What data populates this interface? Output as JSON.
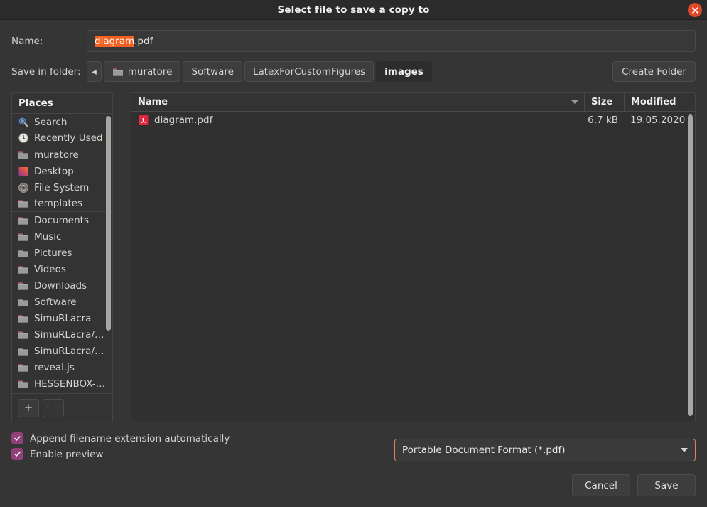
{
  "window": {
    "title": "Select file to save a copy to",
    "close_icon": "close-icon",
    "accent_color": "#e0482a"
  },
  "name_field": {
    "label": "Name:",
    "selected_text": "diagram",
    "rest_text": ".pdf",
    "full_value": "diagram.pdf"
  },
  "path_bar": {
    "label": "Save in folder:",
    "back_arrow": "◂",
    "crumbs": [
      {
        "label": "muratore",
        "icon": "folder-icon",
        "active": false
      },
      {
        "label": "Software",
        "icon": "",
        "active": false
      },
      {
        "label": "LatexForCustomFigures",
        "icon": "",
        "active": false
      },
      {
        "label": "images",
        "icon": "",
        "active": true
      }
    ],
    "create_folder_label": "Create Folder"
  },
  "sidebar": {
    "header": "Places",
    "items": [
      {
        "label": "Search",
        "icon": "search-icon"
      },
      {
        "label": "Recently Used",
        "icon": "recent-icon",
        "separator_after": true
      },
      {
        "label": "muratore",
        "icon": "folder-icon"
      },
      {
        "label": "Desktop",
        "icon": "desktop-icon"
      },
      {
        "label": "File System",
        "icon": "disk-icon"
      },
      {
        "label": "templates",
        "icon": "folder-icon",
        "separator_after": true
      },
      {
        "label": "Documents",
        "icon": "folder-icon"
      },
      {
        "label": "Music",
        "icon": "folder-icon"
      },
      {
        "label": "Pictures",
        "icon": "folder-icon"
      },
      {
        "label": "Videos",
        "icon": "folder-icon"
      },
      {
        "label": "Downloads",
        "icon": "folder-icon"
      },
      {
        "label": "Software",
        "icon": "folder-icon"
      },
      {
        "label": "SimuRLacra",
        "icon": "folder-icon"
      },
      {
        "label": "SimuRLacra/…",
        "icon": "folder-icon"
      },
      {
        "label": "SimuRLacra/…",
        "icon": "folder-icon"
      },
      {
        "label": "reveal.js",
        "icon": "folder-icon"
      },
      {
        "label": "HESSENBOX-…",
        "icon": "folder-icon"
      }
    ],
    "add_button": "+",
    "more_button": "·····"
  },
  "file_list": {
    "columns": {
      "name": "Name",
      "size": "Size",
      "modified": "Modified"
    },
    "sort_icon": "sort-descending-icon",
    "rows": [
      {
        "name": "diagram.pdf",
        "size": "6,7 kB",
        "modified": "19.05.2020",
        "icon": "pdf-file-icon"
      }
    ]
  },
  "options": {
    "append_extension": {
      "label": "Append filename extension automatically",
      "checked": true
    },
    "enable_preview": {
      "label": "Enable preview",
      "checked": true
    },
    "file_format": {
      "selected": "Portable Document Format (*.pdf)"
    },
    "checkbox_color": "#92407a"
  },
  "actions": {
    "cancel": "Cancel",
    "save": "Save"
  }
}
